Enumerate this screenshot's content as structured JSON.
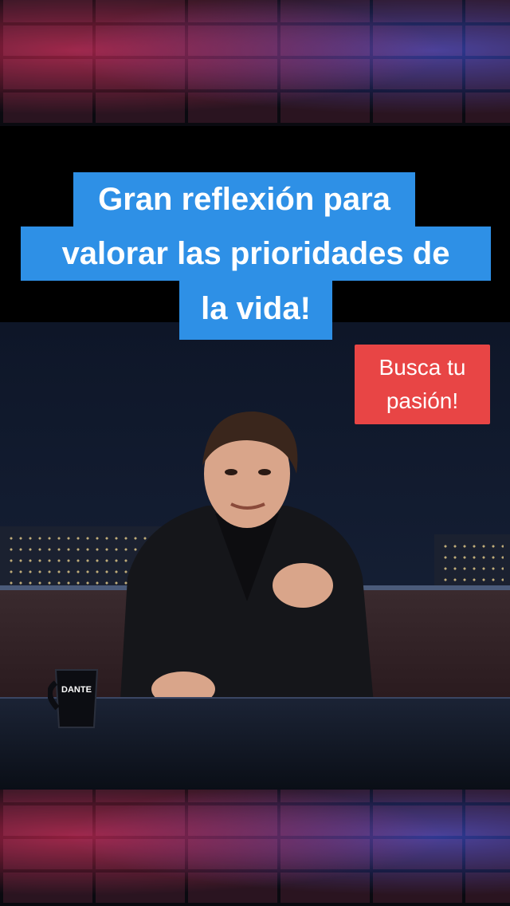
{
  "overlay": {
    "caption_lines": [
      "Gran reflexión para",
      "valorar las prioridades de",
      "la vida!"
    ],
    "sticker_lines": [
      "Busca tu",
      "pasión!"
    ]
  },
  "scene": {
    "mug_text": "DANTE"
  },
  "colors": {
    "caption_bg": "#2e90e6",
    "sticker_bg": "#e84545",
    "text": "#ffffff"
  }
}
